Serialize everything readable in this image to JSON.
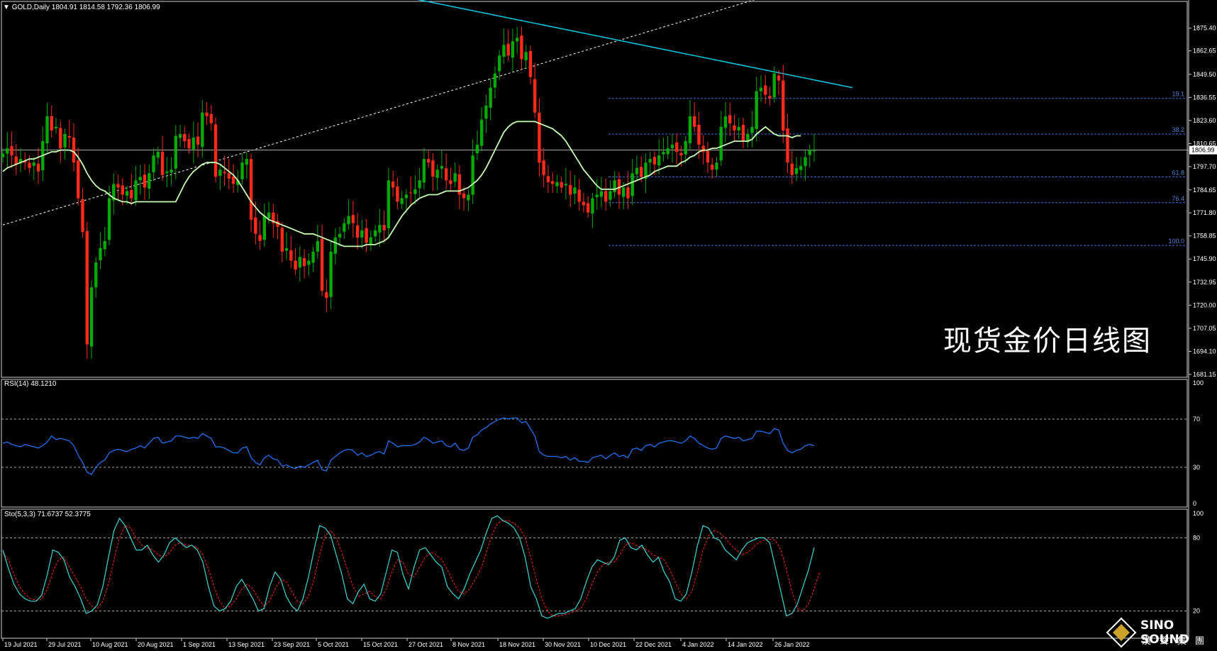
{
  "header": {
    "symbol_line": "GOLD,Daily  1804.91 1814.58 1792.36 1806.99",
    "arrow": "▼"
  },
  "rsi_label": "RSI(14) 48.1210",
  "sto_label": "Sto(5,3,3) 71.6737 52.3775",
  "watermark_title": "现货金价日线图",
  "brand": {
    "name": "SINO SOUND",
    "sub": "漢聲集團"
  },
  "colors": {
    "up": "#00aa00",
    "down": "#ff2a1a",
    "ma": "#c8ffb4",
    "rsi": "#1e78ff",
    "stoch_main": "#3ad6d6",
    "stoch_signal": "#ff2020",
    "trendline": "#00c8e0",
    "fib": "#3a6fe0",
    "grid": "#ffffff"
  },
  "chart_data": [
    {
      "type": "candlestick",
      "title": "GOLD,Daily",
      "ohlc_last": {
        "open": 1804.91,
        "high": 1814.58,
        "low": 1792.36,
        "close": 1806.99
      },
      "current_price_label": "1806.99",
      "y_ticks": [
        "1875.40",
        "1862.65",
        "1849.50",
        "1836.55",
        "1823.60",
        "1810.65",
        "1797.70",
        "1784.65",
        "1771.80",
        "1758.85",
        "1745.90",
        "1732.95",
        "1720.00",
        "1707.05",
        "1694.10",
        "1681.15"
      ],
      "ylim": [
        1681.15,
        1890
      ],
      "x_ticks": [
        "19 Jul 2021",
        "29 Jul 2021",
        "10 Aug 2021",
        "20 Aug 2021",
        "1 Sep 2021",
        "13 Sep 2021",
        "23 Sep 2021",
        "5 Oct 2021",
        "15 Oct 2021",
        "27 Oct 2021",
        "8 Nov 2021",
        "18 Nov 2021",
        "30 Nov 2021",
        "10 Dec 2021",
        "22 Dec 2021",
        "4 Jan 2022",
        "14 Jan 2022",
        "26 Jan 2022"
      ],
      "fib_levels": [
        {
          "label": "19.1",
          "price": 1836.0
        },
        {
          "label": "38.2",
          "price": 1816.0
        },
        {
          "label": "61.8",
          "price": 1792.0
        },
        {
          "label": "76.4",
          "price": 1777.5
        },
        {
          "label": "100.0",
          "price": 1753.5
        }
      ],
      "close_series": [
        1805,
        1808,
        1804,
        1799,
        1802,
        1800,
        1797,
        1800,
        1795,
        1812,
        1826,
        1818,
        1820,
        1808,
        1816,
        1814,
        1800,
        1780,
        1761,
        1698,
        1730,
        1744,
        1752,
        1756,
        1780,
        1788,
        1786,
        1782,
        1784,
        1780,
        1790,
        1792,
        1786,
        1794,
        1804,
        1806,
        1793,
        1795,
        1796,
        1815,
        1816,
        1812,
        1808,
        1814,
        1810,
        1828,
        1826,
        1822,
        1792,
        1796,
        1794,
        1791,
        1788,
        1790,
        1800,
        1802,
        1768,
        1760,
        1756,
        1770,
        1772,
        1766,
        1764,
        1750,
        1752,
        1745,
        1740,
        1747,
        1742,
        1745,
        1750,
        1756,
        1728,
        1724,
        1750,
        1758,
        1760,
        1766,
        1770,
        1766,
        1758,
        1762,
        1755,
        1758,
        1762,
        1765,
        1762,
        1790,
        1786,
        1778,
        1780,
        1782,
        1783,
        1785,
        1790,
        1802,
        1800,
        1792,
        1796,
        1798,
        1790,
        1788,
        1794,
        1782,
        1780,
        1782,
        1804,
        1810,
        1824,
        1832,
        1842,
        1850,
        1860,
        1866,
        1860,
        1868,
        1870,
        1858,
        1862,
        1848,
        1828,
        1800,
        1793,
        1789,
        1788,
        1789,
        1786,
        1788,
        1782,
        1786,
        1778,
        1776,
        1772,
        1780,
        1782,
        1784,
        1778,
        1784,
        1790,
        1782,
        1786,
        1780,
        1794,
        1797,
        1792,
        1800,
        1802,
        1799,
        1804,
        1806,
        1808,
        1810,
        1806,
        1804,
        1812,
        1826,
        1820,
        1810,
        1806,
        1800,
        1796,
        1800,
        1820,
        1826,
        1822,
        1818,
        1820,
        1812,
        1816,
        1820,
        1840,
        1842,
        1838,
        1836,
        1850,
        1846,
        1818,
        1800,
        1793,
        1797,
        1798,
        1803,
        1807,
        1807
      ],
      "ma_series": [
        1795,
        1797,
        1798,
        1799,
        1800,
        1801,
        1802,
        1802,
        1803,
        1804,
        1805,
        1806,
        1806,
        1807,
        1807,
        1807,
        1806,
        1803,
        1799,
        1794,
        1790,
        1787,
        1785,
        1784,
        1782,
        1780,
        1779,
        1778,
        1778,
        1777,
        1778,
        1778,
        1778,
        1778,
        1778,
        1778,
        1778,
        1778,
        1778,
        1778,
        1783,
        1788,
        1792,
        1795,
        1797,
        1799,
        1800,
        1800,
        1800,
        1799,
        1797,
        1795,
        1793,
        1790,
        1786,
        1782,
        1778,
        1775,
        1772,
        1770,
        1768,
        1767,
        1766,
        1765,
        1764,
        1763,
        1762,
        1761,
        1760,
        1760,
        1760,
        1759,
        1758,
        1757,
        1756,
        1755,
        1754,
        1753,
        1753,
        1753,
        1753,
        1753,
        1754,
        1754,
        1754,
        1755,
        1756,
        1758,
        1762,
        1766,
        1770,
        1773,
        1776,
        1778,
        1780,
        1781,
        1782,
        1782,
        1782,
        1783,
        1784,
        1784,
        1784,
        1784,
        1785,
        1786,
        1788,
        1790,
        1793,
        1797,
        1802,
        1807,
        1812,
        1817,
        1820,
        1822,
        1823,
        1823,
        1823,
        1823,
        1823,
        1822,
        1821,
        1820,
        1819,
        1817,
        1815,
        1812,
        1808,
        1804,
        1800,
        1796,
        1793,
        1790,
        1787,
        1785,
        1785,
        1785,
        1785,
        1786,
        1787,
        1788,
        1789,
        1790,
        1791,
        1792,
        1793,
        1795,
        1796,
        1797,
        1798,
        1798,
        1798,
        1800,
        1801,
        1803,
        1804,
        1806,
        1807,
        1807,
        1808,
        1808,
        1809,
        1810,
        1811,
        1812,
        1812,
        1812,
        1812,
        1813,
        1816,
        1818,
        1820,
        1818,
        1816,
        1815,
        1815,
        1815,
        1814,
        1815,
        1815
      ],
      "sma_period_note": ""
    },
    {
      "type": "line",
      "title": "RSI(14) 48.1210",
      "ylim": [
        0,
        100
      ],
      "levels": [
        30,
        70
      ],
      "y_ticks": [
        "100",
        "70",
        "30",
        "0"
      ],
      "values": [
        50,
        51,
        49,
        48,
        47,
        49,
        48,
        47,
        46,
        48,
        51,
        56,
        53,
        54,
        53,
        52,
        48,
        40,
        34,
        26,
        24,
        30,
        34,
        36,
        42,
        44,
        45,
        44,
        43,
        45,
        46,
        48,
        46,
        50,
        54,
        55,
        50,
        51,
        52,
        56,
        56,
        55,
        54,
        55,
        54,
        58,
        56,
        54,
        47,
        47,
        46,
        44,
        42,
        42,
        46,
        47,
        38,
        34,
        32,
        38,
        40,
        37,
        36,
        31,
        32,
        30,
        29,
        31,
        30,
        32,
        34,
        36,
        28,
        27,
        36,
        39,
        42,
        44,
        45,
        44,
        40,
        42,
        39,
        40,
        42,
        43,
        41,
        52,
        50,
        47,
        48,
        48,
        48,
        49,
        51,
        55,
        53,
        50,
        51,
        52,
        48,
        47,
        50,
        45,
        44,
        46,
        55,
        57,
        61,
        63,
        66,
        68,
        70,
        71,
        70,
        71,
        71,
        67,
        68,
        62,
        56,
        43,
        40,
        39,
        39,
        39,
        38,
        39,
        36,
        38,
        35,
        35,
        34,
        38,
        39,
        40,
        37,
        40,
        42,
        39,
        40,
        38,
        45,
        46,
        44,
        48,
        49,
        47,
        50,
        51,
        52,
        52,
        51,
        50,
        52,
        56,
        54,
        50,
        48,
        46,
        45,
        46,
        54,
        56,
        55,
        54,
        55,
        52,
        53,
        54,
        60,
        60,
        59,
        58,
        62,
        61,
        50,
        44,
        42,
        44,
        45,
        48,
        49,
        48
      ]
    },
    {
      "type": "line",
      "title": "Sto(5,3,3) 71.6737 52.3775",
      "ylim": [
        0,
        100
      ],
      "levels": [
        20,
        80
      ],
      "y_ticks": [
        "100",
        "80",
        "20"
      ],
      "series": [
        {
          "values": [
            70,
            55,
            42,
            34,
            30,
            28,
            28,
            33,
            50,
            70,
            68,
            62,
            48,
            40,
            30,
            18,
            20,
            25,
            40,
            64,
            86,
            96,
            90,
            80,
            70,
            70,
            74,
            66,
            60,
            66,
            76,
            80,
            76,
            72,
            74,
            70,
            60,
            40,
            24,
            20,
            22,
            28,
            40,
            46,
            38,
            30,
            20,
            22,
            40,
            52,
            46,
            32,
            24,
            20,
            30,
            48,
            70,
            90,
            88,
            82,
            66,
            50,
            30,
            26,
            36,
            42,
            30,
            28,
            34,
            52,
            70,
            68,
            50,
            38,
            56,
            70,
            72,
            66,
            60,
            56,
            40,
            34,
            30,
            38,
            50,
            60,
            70,
            84,
            96,
            98,
            94,
            92,
            88,
            80,
            64,
            40,
            30,
            16,
            14,
            16,
            18,
            18,
            20,
            22,
            30,
            44,
            56,
            62,
            60,
            58,
            64,
            78,
            80,
            72,
            70,
            74,
            66,
            60,
            64,
            52,
            44,
            30,
            28,
            34,
            52,
            74,
            90,
            88,
            80,
            78,
            70,
            66,
            62,
            70,
            76,
            78,
            80,
            80,
            76,
            56,
            36,
            16,
            18,
            26,
            40,
            54,
            72
          ],
          "name": ""
        },
        {
          "values": [
            68,
            62,
            50,
            40,
            34,
            30,
            29,
            30,
            38,
            52,
            62,
            64,
            56,
            48,
            40,
            30,
            24,
            22,
            28,
            42,
            62,
            80,
            90,
            88,
            80,
            74,
            72,
            70,
            66,
            64,
            68,
            74,
            76,
            74,
            74,
            72,
            66,
            54,
            40,
            28,
            22,
            24,
            30,
            38,
            42,
            38,
            30,
            24,
            28,
            38,
            46,
            44,
            36,
            28,
            26,
            32,
            46,
            66,
            82,
            86,
            80,
            68,
            54,
            40,
            32,
            34,
            36,
            32,
            30,
            38,
            52,
            62,
            60,
            50,
            48,
            56,
            64,
            68,
            66,
            62,
            54,
            44,
            36,
            34,
            38,
            46,
            54,
            68,
            82,
            92,
            94,
            94,
            92,
            88,
            80,
            64,
            46,
            30,
            20,
            16,
            16,
            17,
            18,
            20,
            22,
            30,
            42,
            52,
            58,
            60,
            60,
            66,
            74,
            76,
            74,
            72,
            70,
            66,
            64,
            62,
            54,
            44,
            34,
            30,
            36,
            52,
            70,
            82,
            86,
            84,
            80,
            74,
            70,
            66,
            68,
            72,
            76,
            78,
            79,
            78,
            70,
            54,
            36,
            22,
            20,
            26,
            38,
            52
          ],
          "name": ""
        }
      ]
    }
  ]
}
